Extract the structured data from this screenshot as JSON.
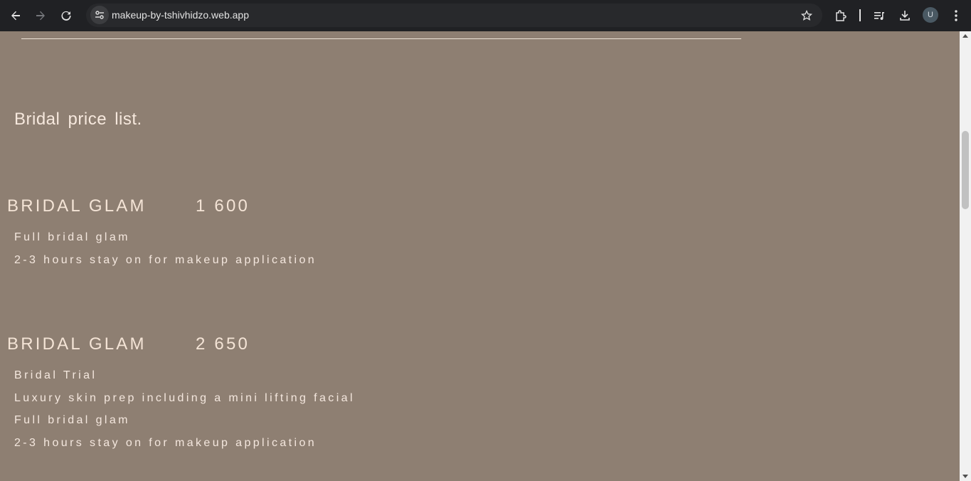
{
  "browser": {
    "url": "makeup-by-tshivhidzo.web.app",
    "profile_initial": "U"
  },
  "page": {
    "section_title": "Bridal price list.",
    "packages": [
      {
        "name": "BRIDAL GLAM",
        "price": "1 600",
        "features": [
          "Full bridal glam",
          "2-3 hours stay on for makeup application"
        ]
      },
      {
        "name": "BRIDAL GLAM",
        "price": "2 650",
        "features": [
          "Bridal Trial",
          "Luxury skin prep including a mini lifting facial",
          "Full bridal glam",
          "2-3 hours stay on for makeup application"
        ]
      }
    ]
  },
  "colors": {
    "background": "#8e7f72",
    "text": "#f4e4d6",
    "toolbar": "#202124"
  }
}
